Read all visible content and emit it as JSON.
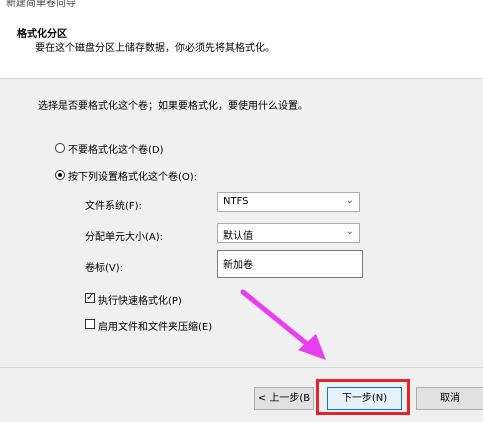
{
  "window": {
    "title": "新建简单卷向导"
  },
  "header": {
    "title": "格式化分区",
    "subtitle": "要在这个磁盘分区上储存数据，你必须先将其格式化。"
  },
  "main": {
    "prompt": "选择是否要格式化这个卷；如果要格式化，要使用什么设置。",
    "options": {
      "no_format": {
        "label": "不要格式化这个卷(D)",
        "checked": false
      },
      "format": {
        "label": "按下列设置格式化这个卷(O):",
        "checked": true
      }
    },
    "fields": {
      "file_system": {
        "label": "文件系统(F):",
        "value": "NTFS"
      },
      "allocation": {
        "label": "分配单元大小(A):",
        "value": "默认值"
      },
      "volume_label": {
        "label": "卷标(V):",
        "value": "新加卷"
      }
    },
    "checkboxes": {
      "quick_format": {
        "label": "执行快速格式化(P)",
        "checked": true
      },
      "compression": {
        "label": "启用文件和文件夹压缩(E)",
        "checked": false
      }
    }
  },
  "footer": {
    "back_label": "< 上一步(B",
    "next_label": "下一步(N)",
    "cancel_label": "取消"
  },
  "annotation": {
    "highlight_color": "#e8232a",
    "arrow_color": "#e83ef0"
  },
  "icons": {
    "chevron": "chevron-down-icon",
    "check": "checkmark-icon"
  }
}
